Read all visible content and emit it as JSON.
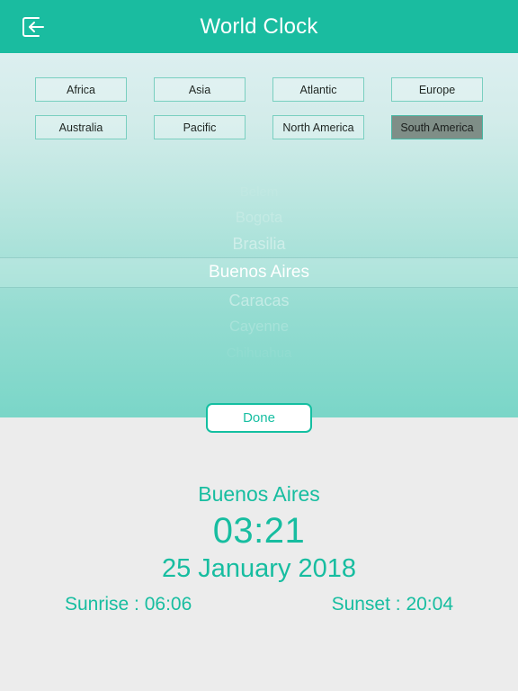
{
  "header": {
    "title": "World Clock",
    "back_icon": "exit-left-arrow-icon"
  },
  "regions": {
    "row1": [
      {
        "label": "Africa",
        "selected": false
      },
      {
        "label": "Asia",
        "selected": false
      },
      {
        "label": "Atlantic",
        "selected": false
      },
      {
        "label": "Europe",
        "selected": false
      }
    ],
    "row2": [
      {
        "label": "Australia",
        "selected": false
      },
      {
        "label": "Pacific",
        "selected": false
      },
      {
        "label": "North America",
        "selected": false
      },
      {
        "label": "South America",
        "selected": true
      }
    ]
  },
  "picker": {
    "items": [
      {
        "label": "Belem",
        "state": "far-faded"
      },
      {
        "label": "Bogota",
        "state": "faded"
      },
      {
        "label": "Brasilia",
        "state": "dim"
      },
      {
        "label": "Buenos Aires",
        "state": "selected"
      },
      {
        "label": "Caracas",
        "state": "dim"
      },
      {
        "label": "Cayenne",
        "state": "faded"
      },
      {
        "label": "Chihuahua",
        "state": "far-faded"
      }
    ],
    "selected_value": "Buenos Aires"
  },
  "done_button": {
    "label": "Done"
  },
  "info": {
    "city": "Buenos Aires",
    "time": "03:21",
    "date": "25 January 2018",
    "sunrise": "Sunrise : 06:06",
    "sunset": "Sunset : 20:04"
  },
  "colors": {
    "accent": "#17bda0",
    "header": "#1abca0",
    "panel": "#ececec",
    "selected_region": "#7f8e87"
  }
}
